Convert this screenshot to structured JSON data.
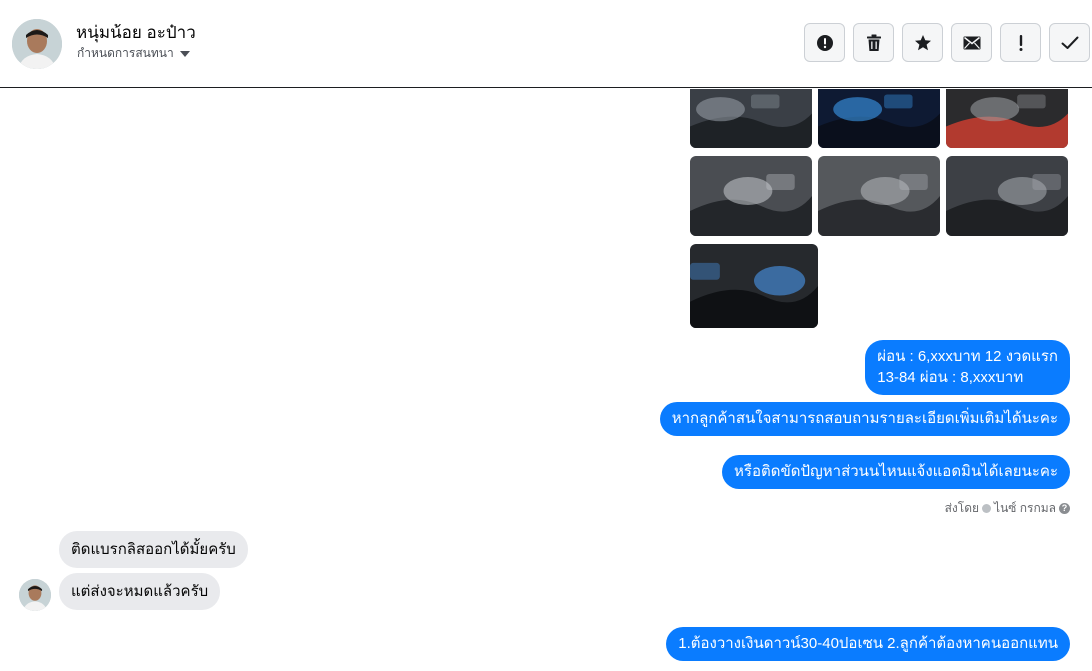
{
  "header": {
    "contact_name": "หนุ่มน้อย อะป๋าว",
    "conversation_settings": "กำหนดการสนทนา"
  },
  "toolbar": {
    "buttons": [
      {
        "name": "report-button",
        "icon": "alert-circle-icon"
      },
      {
        "name": "delete-button",
        "icon": "trash-icon"
      },
      {
        "name": "star-button",
        "icon": "star-icon"
      },
      {
        "name": "mark-unread-button",
        "icon": "envelope-icon"
      },
      {
        "name": "important-button",
        "icon": "exclamation-icon"
      },
      {
        "name": "done-button",
        "icon": "checkmark-icon"
      }
    ]
  },
  "photos": [
    {
      "name": "photo-interior-dashboard",
      "palette": [
        "#3a3f46",
        "#9aa3ab",
        "#1e2226"
      ]
    },
    {
      "name": "photo-instrument-cluster",
      "palette": [
        "#0e1a33",
        "#3fa8ff",
        "#0a0f1c"
      ]
    },
    {
      "name": "photo-engine-bay",
      "palette": [
        "#2b2b2d",
        "#a0a4a8",
        "#b23a2f"
      ]
    },
    {
      "name": "photo-front-seats",
      "palette": [
        "#4a4d52",
        "#c9ccd0",
        "#23262a"
      ]
    },
    {
      "name": "photo-rear-seats",
      "palette": [
        "#55585c",
        "#b8bbbf",
        "#2a2c30"
      ]
    },
    {
      "name": "photo-gear-shifter",
      "palette": [
        "#3d4045",
        "#a9adb2",
        "#1f2124"
      ]
    },
    {
      "name": "photo-steering-wheel",
      "palette": [
        "#26292d",
        "#4da3ff",
        "#0f1114"
      ]
    }
  ],
  "messages": {
    "out_1_line_1": "ผ่อน : 6,xxxบาท 12 งวดแรก",
    "out_1_line_2": "13-84 ผ่อน : 8,xxxบาท",
    "out_2": "หากลูกค้าสนใจสามารถสอบถามรายละเอียดเพิ่มเติมได้นะคะ",
    "out_3": "หรือติดขัดปัญหาส่วนนไหนแจ้งแอดมินได้เลยนะคะ",
    "sent_by_label": "ส่งโดย",
    "sent_by_name": "ไนซ์ กรกมล",
    "in_1": "ติดแบรกลิสออกได้มั้ยครับ",
    "in_2": "แต่ส่งจะหมดแล้วครับ",
    "out_4": "1.ต้องวางเงินดาวน์30-40ปอเซน 2.ลูกค้าต้องหาคนออกแทน"
  },
  "colors": {
    "outgoing_bubble": "#0a7cff",
    "incoming_bubble": "#e9eaed",
    "toolbar_button_bg": "#f5f6f7"
  }
}
